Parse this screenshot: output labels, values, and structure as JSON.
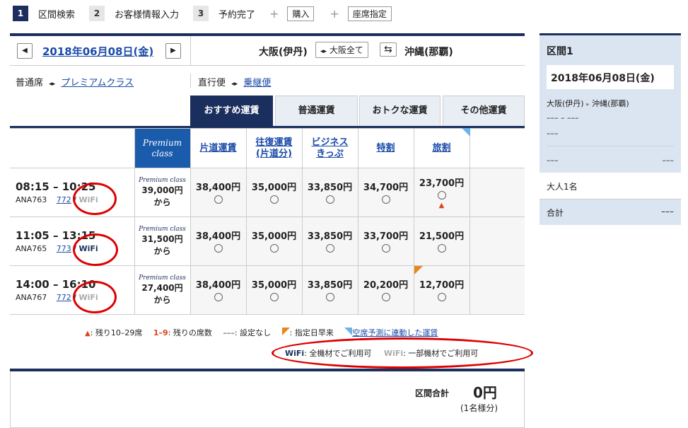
{
  "steps": [
    {
      "num": "1",
      "label": "区間検索"
    },
    {
      "num": "2",
      "label": "お客様情報入力"
    },
    {
      "num": "3",
      "label": "予約完了"
    }
  ],
  "extras": [
    "購入",
    "座席指定"
  ],
  "date_bar": {
    "prev": "◀",
    "next": "▶",
    "date": "2018年06月08日(金)",
    "origin": "大阪(伊丹)",
    "origin_all": "大阪全て",
    "dest": "沖縄(那覇)",
    "swap_icon": "⇆"
  },
  "seat_class": {
    "current": "普通席",
    "other": "プレミアムクラス",
    "direct": "直行便",
    "connect": "乗継便"
  },
  "tabs": [
    "おすすめ運賃",
    "普通運賃",
    "おトクな運賃",
    "その他運賃"
  ],
  "premium_header": {
    "line1": "Premium",
    "line2": "class"
  },
  "fare_headers": [
    "片道運賃",
    "往復運賃\n(片道分)",
    "ビジネス\nきっぷ",
    "特割",
    "旅割"
  ],
  "flights": [
    {
      "time": "08:15 – 10:25",
      "flight": "ANA763",
      "aircraft": "772",
      "wifi": "WiFi",
      "wifi_all": false,
      "premium_label": "Premium class",
      "premium_price": "39,000円",
      "premium_from": "から",
      "fares": [
        "38,400円",
        "35,000円",
        "33,850円",
        "34,700円",
        "23,700円"
      ],
      "remaining_flag": "▲"
    },
    {
      "time": "11:05 – 13:15",
      "flight": "ANA765",
      "aircraft": "773",
      "wifi": "WiFi",
      "wifi_all": true,
      "premium_label": "Premium class",
      "premium_price": "31,500円",
      "premium_from": "から",
      "fares": [
        "38,400円",
        "35,000円",
        "33,850円",
        "33,700円",
        "21,500円"
      ]
    },
    {
      "time": "14:00 – 16:10",
      "flight": "ANA767",
      "aircraft": "772",
      "wifi": "WiFi",
      "wifi_all": false,
      "premium_label": "Premium class",
      "premium_price": "27,400円",
      "premium_from": "から",
      "fares": [
        "38,400円",
        "35,000円",
        "33,850円",
        "20,200円",
        "12,700円"
      ]
    }
  ],
  "legend": {
    "tri": "▲",
    "tri_text": ": 残り10–29席",
    "range": "1–9",
    "range_text": ": 残りの席数",
    "none": "–––",
    "none_text": ": 設定なし",
    "orange_text": ": 指定日早来",
    "blue_link": "空席予測に連動した運賃",
    "wifi_all_label": "WiFi",
    "wifi_all_text": ": 全機材でご利用可",
    "wifi_some_label": "WiFi",
    "wifi_some_text": ": 一部機材でご利用可"
  },
  "total": {
    "label": "区間合計",
    "amount": "0円",
    "note": "(1名様分)"
  },
  "sidebar": {
    "title": "区間1",
    "date": "2018年06月08日(金)",
    "origin": "大阪(伊丹)",
    "dest": "沖縄(那覇)",
    "line1": "––– – –––",
    "line2": "–––",
    "left3": "–––",
    "right3": "–––",
    "adults": "大人1名",
    "sum_label": "合計",
    "sum_value": "–––"
  }
}
